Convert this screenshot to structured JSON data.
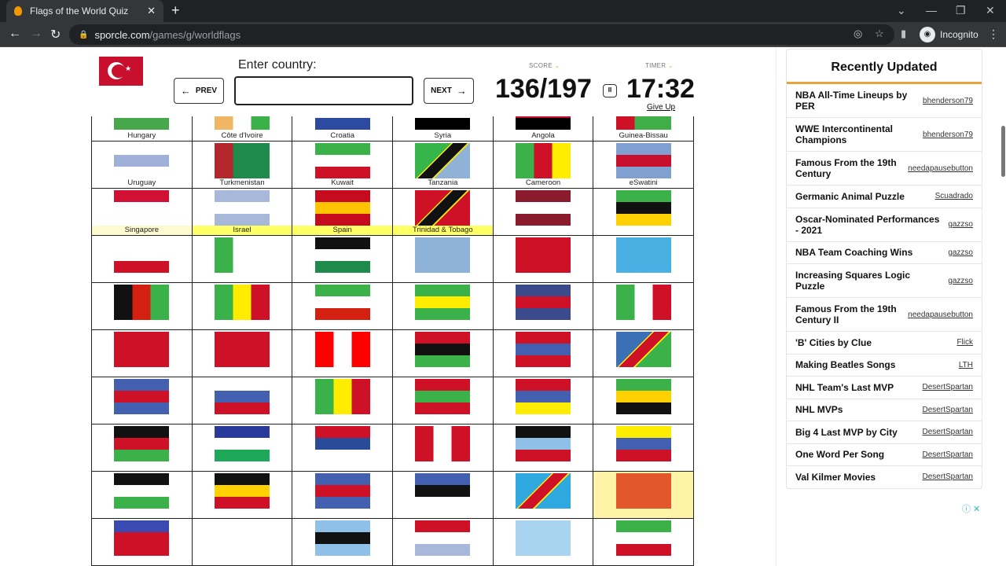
{
  "browser": {
    "tab_title": "Flags of the World Quiz",
    "url_domain": "sporcle.com",
    "url_path": "/games/g/worldflags",
    "profile": "Incognito"
  },
  "quiz": {
    "prompt_label": "Enter country:",
    "answer_value": "",
    "prev_label": "PREV",
    "next_label": "NEXT",
    "score_label": "SCORE",
    "timer_label": "TIMER",
    "score": "136/197",
    "timer": "17:32",
    "give_up": "Give Up",
    "current_flag": "Turkey"
  },
  "grid": [
    [
      {
        "name": "Hungary",
        "c": [
          "#ce2939",
          "#fff",
          "#47a74b"
        ],
        "t": "h"
      },
      {
        "name": "Côte d'Ivoire",
        "c": [
          "#f1b664",
          "#fff",
          "#3bb14a"
        ],
        "t": "v"
      },
      {
        "name": "Croatia",
        "c": [
          "#e3262c",
          "#fff",
          "#2b4aa0"
        ],
        "t": "h"
      },
      {
        "name": "Syria",
        "c": [
          "#ce1126",
          "#fff",
          "#000"
        ],
        "t": "h"
      },
      {
        "name": "Angola",
        "c": [
          "#cc092f",
          "#cc092f",
          "#000"
        ],
        "t": "h"
      },
      {
        "name": "Guinea-Bissau",
        "c": [
          "#ce1126",
          "#3fae49",
          "#3fae49"
        ],
        "t": "v"
      }
    ],
    [
      {
        "name": "Uruguay",
        "c": [
          "#fff",
          "#9fb1d8",
          "#fff"
        ],
        "t": "h"
      },
      {
        "name": "Turkmenistan",
        "c": [
          "#b2262c",
          "#1e8a4c",
          "#1e8a4c"
        ],
        "t": "v"
      },
      {
        "name": "Kuwait",
        "c": [
          "#3bb14a",
          "#fff",
          "#ce1126"
        ],
        "t": "h"
      },
      {
        "name": "Tanzania",
        "c": [
          "#36b54a",
          "#111",
          "#8fb2d6"
        ],
        "t": "d"
      },
      {
        "name": "Cameroon",
        "c": [
          "#3bb14a",
          "#ce1126",
          "#ffed00"
        ],
        "t": "v"
      },
      {
        "name": "eSwatini",
        "c": [
          "#7fa0d0",
          "#c8102e",
          "#7fa0d0"
        ],
        "t": "h"
      }
    ],
    [
      {
        "name": "Singapore",
        "c": [
          "#d21034",
          "#fff",
          "#fff"
        ],
        "t": "h",
        "hl": "p"
      },
      {
        "name": "Israel",
        "c": [
          "#a8b8da",
          "#fff",
          "#a8b8da"
        ],
        "t": "h",
        "hl": "y"
      },
      {
        "name": "Spain",
        "c": [
          "#c60b1e",
          "#ffc400",
          "#c60b1e"
        ],
        "t": "h",
        "hl": "y"
      },
      {
        "name": "Trinidad & Tobago",
        "c": [
          "#ce1126",
          "#111",
          "#ce1126"
        ],
        "t": "d",
        "hl": "y"
      },
      {
        "name": "",
        "c": [
          "#8a1b2c",
          "#fff",
          "#8a1b2c"
        ],
        "t": "h"
      },
      {
        "name": "",
        "c": [
          "#3bb14a",
          "#111",
          "#ffd100"
        ],
        "t": "h"
      }
    ],
    [
      {
        "name": "",
        "c": [
          "#fff",
          "#fff",
          "#ce1126"
        ],
        "t": "h"
      },
      {
        "name": "",
        "c": [
          "#3bb14a",
          "#fff",
          "#fff"
        ],
        "t": "v"
      },
      {
        "name": "",
        "c": [
          "#111",
          "#fff",
          "#1e8a4c"
        ],
        "t": "h"
      },
      {
        "name": "",
        "c": [
          "#8fb2d8",
          "#8fb2d8",
          "#8fb2d8"
        ],
        "t": "h"
      },
      {
        "name": "",
        "c": [
          "#ce1126",
          "#ce1126",
          "#ce1126"
        ],
        "t": "h"
      },
      {
        "name": "",
        "c": [
          "#49b0e3",
          "#49b0e3",
          "#49b0e3"
        ],
        "t": "h"
      }
    ],
    [
      {
        "name": "",
        "c": [
          "#111",
          "#d32011",
          "#3bb14a"
        ],
        "t": "v"
      },
      {
        "name": "",
        "c": [
          "#3bb14a",
          "#ffed00",
          "#ce1126"
        ],
        "t": "v"
      },
      {
        "name": "",
        "c": [
          "#3bb14a",
          "#fff",
          "#d32011"
        ],
        "t": "h"
      },
      {
        "name": "",
        "c": [
          "#3bb14a",
          "#ffed00",
          "#3bb14a"
        ],
        "t": "h"
      },
      {
        "name": "",
        "c": [
          "#3a4a8a",
          "#ce1126",
          "#3a4a8a"
        ],
        "t": "h"
      },
      {
        "name": "",
        "c": [
          "#3bb14a",
          "#fff",
          "#ce1126"
        ],
        "t": "v"
      }
    ],
    [
      {
        "name": "",
        "c": [
          "#ce1126",
          "#ce1126",
          "#ce1126"
        ],
        "t": "h"
      },
      {
        "name": "",
        "c": [
          "#ce1126",
          "#ce1126",
          "#ce1126"
        ],
        "t": "h"
      },
      {
        "name": "",
        "c": [
          "#ff0000",
          "#fff",
          "#ff0000"
        ],
        "t": "v"
      },
      {
        "name": "",
        "c": [
          "#ce1126",
          "#111",
          "#3bb14a"
        ],
        "t": "h"
      },
      {
        "name": "",
        "c": [
          "#ce1126",
          "#4360b0",
          "#ce1126"
        ],
        "t": "h"
      },
      {
        "name": "",
        "c": [
          "#3b6fb6",
          "#ce1126",
          "#3bb14a"
        ],
        "t": "d"
      }
    ],
    [
      {
        "name": "",
        "c": [
          "#4360b0",
          "#ce1126",
          "#4360b0"
        ],
        "t": "h"
      },
      {
        "name": "",
        "c": [
          "#fff",
          "#4360b0",
          "#ce1126"
        ],
        "t": "h"
      },
      {
        "name": "",
        "c": [
          "#3bb14a",
          "#ffed00",
          "#ce1126"
        ],
        "t": "v"
      },
      {
        "name": "",
        "c": [
          "#ce1126",
          "#3bb14a",
          "#ce1126"
        ],
        "t": "h"
      },
      {
        "name": "",
        "c": [
          "#ce1126",
          "#4360b0",
          "#ffed00"
        ],
        "t": "h"
      },
      {
        "name": "",
        "c": [
          "#3bb14a",
          "#ffd100",
          "#111"
        ],
        "t": "h"
      }
    ],
    [
      {
        "name": "",
        "c": [
          "#111",
          "#ce1126",
          "#3bb14a"
        ],
        "t": "h"
      },
      {
        "name": "",
        "c": [
          "#2a3a9a",
          "#fff",
          "#1ea85a"
        ],
        "t": "h"
      },
      {
        "name": "",
        "c": [
          "#ce1126",
          "#2a4a9a",
          "#fff"
        ],
        "t": "h"
      },
      {
        "name": "",
        "c": [
          "#ce1126",
          "#fff",
          "#ce1126"
        ],
        "t": "v"
      },
      {
        "name": "",
        "c": [
          "#111",
          "#8fc0e8",
          "#ce1126"
        ],
        "t": "h"
      },
      {
        "name": "",
        "c": [
          "#ffed00",
          "#4360b0",
          "#ce1126"
        ],
        "t": "h"
      }
    ],
    [
      {
        "name": "",
        "c": [
          "#111",
          "#fff",
          "#3bb14a"
        ],
        "t": "h"
      },
      {
        "name": "",
        "c": [
          "#111",
          "#ffd100",
          "#ce1126"
        ],
        "t": "h"
      },
      {
        "name": "",
        "c": [
          "#4360b0",
          "#ce1126",
          "#4360b0"
        ],
        "t": "h"
      },
      {
        "name": "",
        "c": [
          "#4360b0",
          "#111",
          "#fff"
        ],
        "t": "h"
      },
      {
        "name": "",
        "c": [
          "#2fa8e0",
          "#ce1126",
          "#2fa8e0"
        ],
        "t": "d"
      },
      {
        "name": "",
        "c": [
          "#e3582a",
          "#e3582a",
          "#e3582a"
        ],
        "t": "h",
        "cur": true
      }
    ],
    [
      {
        "name": "",
        "c": [
          "#3a4ab0",
          "#ce1126",
          "#ce1126"
        ],
        "t": "h"
      },
      {
        "name": "",
        "c": [
          "#fff",
          "#fff",
          "#fff"
        ],
        "t": "h"
      },
      {
        "name": "",
        "c": [
          "#8fc0e8",
          "#111",
          "#8fc0e8"
        ],
        "t": "h"
      },
      {
        "name": "",
        "c": [
          "#ce1126",
          "#fff",
          "#a8b8da"
        ],
        "t": "h"
      },
      {
        "name": "",
        "c": [
          "#a8d4f0",
          "#a8d4f0",
          "#a8d4f0"
        ],
        "t": "h"
      },
      {
        "name": "",
        "c": [
          "#3bb14a",
          "#fff",
          "#ce1126"
        ],
        "t": "h"
      }
    ]
  ],
  "sidebar": {
    "title": "Recently Updated",
    "items": [
      {
        "title": "NBA All-Time Lineups by PER",
        "author": "bhenderson79"
      },
      {
        "title": "WWE Intercontinental Champions",
        "author": "bhenderson79"
      },
      {
        "title": "Famous From the 19th Century",
        "author": "needapausebutton"
      },
      {
        "title": "Germanic Animal Puzzle",
        "author": "Scuadrado"
      },
      {
        "title": "Oscar-Nominated Performances - 2021",
        "author": "gazzso"
      },
      {
        "title": "NBA Team Coaching Wins",
        "author": "gazzso"
      },
      {
        "title": "Increasing Squares Logic Puzzle",
        "author": "gazzso"
      },
      {
        "title": "Famous From the 19th Century II",
        "author": "needapausebutton"
      },
      {
        "title": "'B' Cities by Clue",
        "author": "Flick"
      },
      {
        "title": "Making Beatles Songs",
        "author": "LTH"
      },
      {
        "title": "NHL Team's Last MVP",
        "author": "DesertSpartan"
      },
      {
        "title": "NHL MVPs",
        "author": "DesertSpartan"
      },
      {
        "title": "Big 4 Last MVP by City",
        "author": "DesertSpartan"
      },
      {
        "title": "One Word Per Song",
        "author": "DesertSpartan"
      },
      {
        "title": "Val Kilmer Movies",
        "author": "DesertSpartan"
      }
    ]
  }
}
